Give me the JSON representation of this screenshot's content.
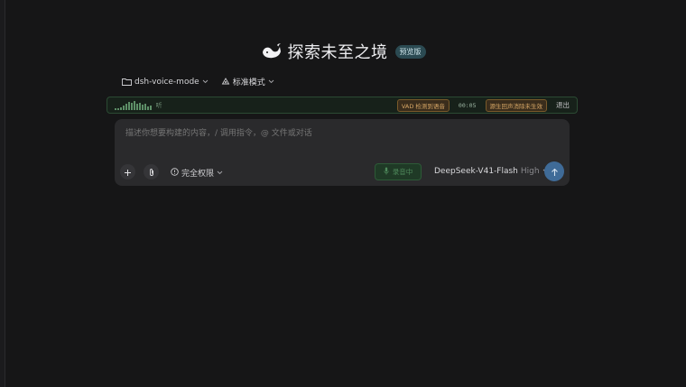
{
  "hero": {
    "title": "探索未至之境",
    "badge": "预览版",
    "logo_icon": "whale-logo"
  },
  "project_row": {
    "folder_label": "dsh-voice-mode",
    "mode_label": "标准模式"
  },
  "voice_bar": {
    "status": "听",
    "vad_badge": "VAD 检测到语音",
    "timer": "00:05",
    "noise_badge": "源生回声消除未生效",
    "exit_label": "退出",
    "accent_color": "#5d8f67"
  },
  "composer": {
    "placeholder": "描述你想要构建的内容，/ 调用指令，@ 文件或对话",
    "permission_label": "完全权限",
    "listening_label": "录音中",
    "model_name": "DeepSeek-V41-Flash",
    "model_effort": "High",
    "send_color": "#3f6b98"
  }
}
